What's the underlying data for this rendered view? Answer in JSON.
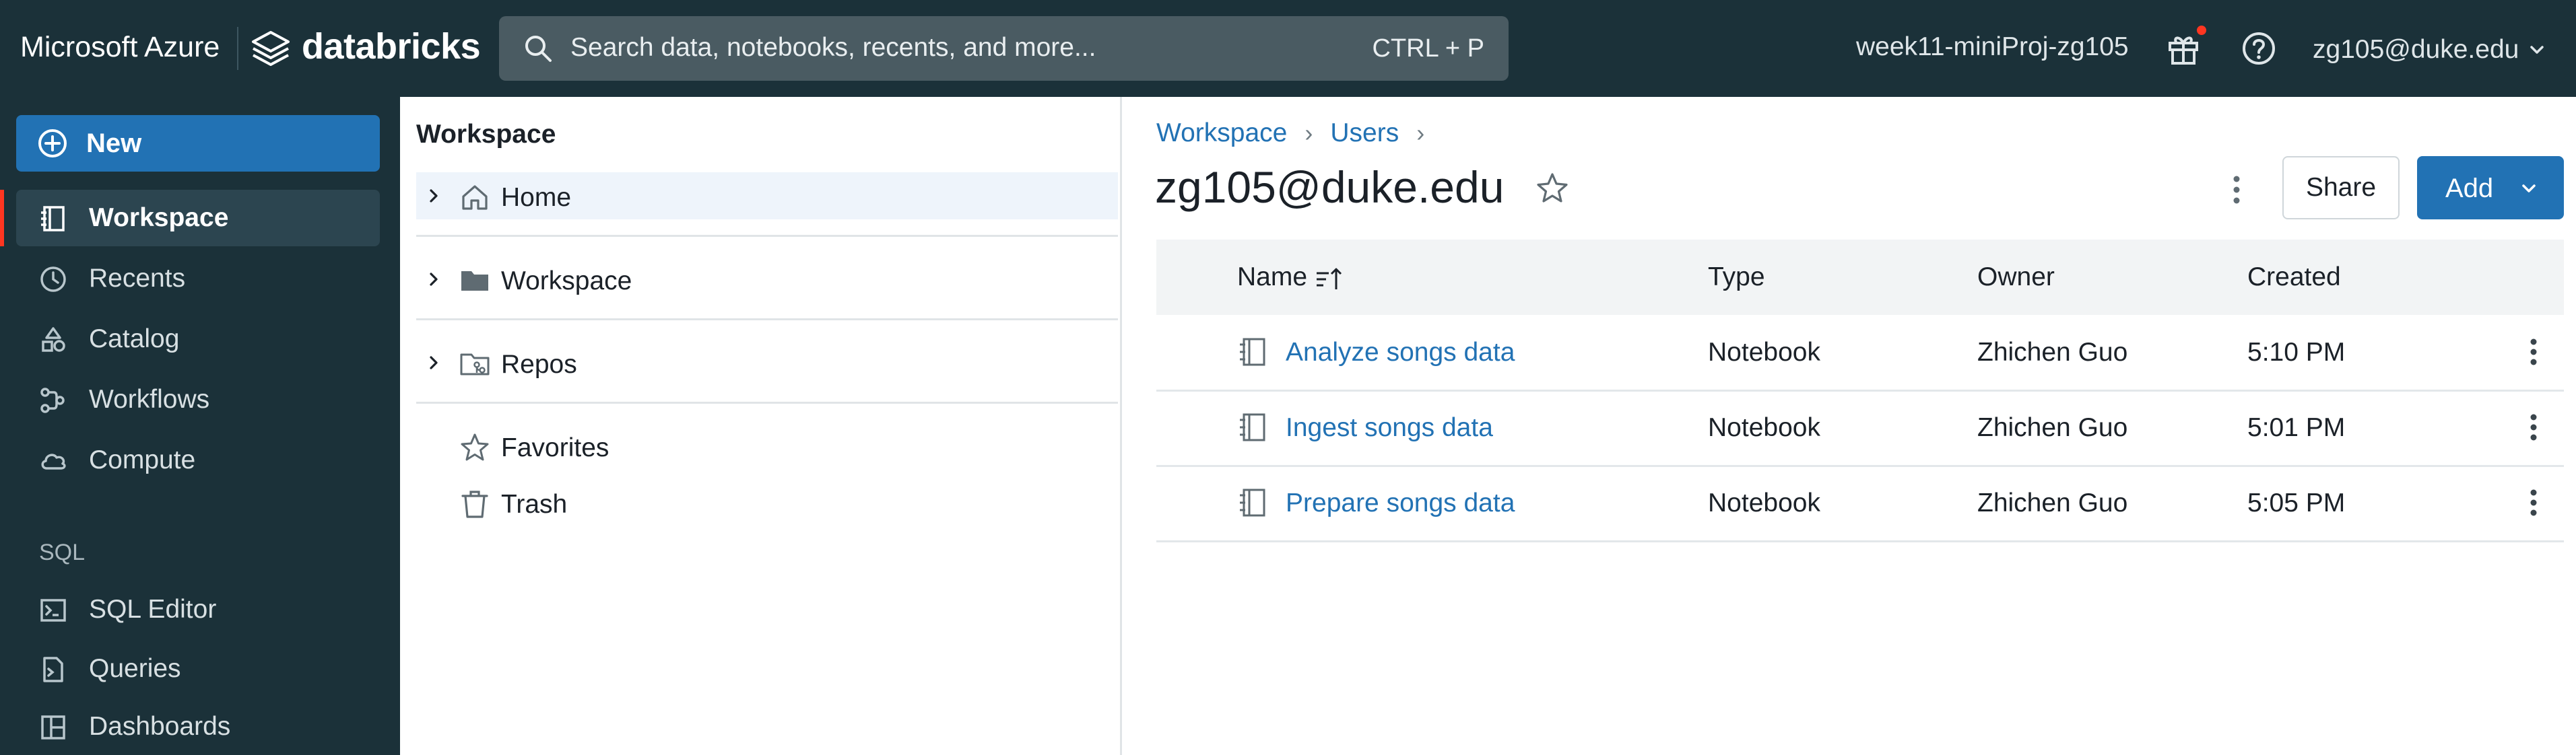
{
  "topbar": {
    "microsoft_label": "Microsoft Azure",
    "databricks_label": "databricks",
    "search_placeholder": "Search data, notebooks, recents, and more...",
    "search_shortcut": "CTRL + P",
    "workspace_name": "week11-miniProj-zg105",
    "user": "zg105@duke.edu"
  },
  "sidebar": {
    "new_label": "New",
    "items": [
      {
        "label": "Workspace",
        "icon": "workspace-icon",
        "active": true
      },
      {
        "label": "Recents",
        "icon": "clock-icon"
      },
      {
        "label": "Catalog",
        "icon": "catalog-icon"
      },
      {
        "label": "Workflows",
        "icon": "workflows-icon"
      },
      {
        "label": "Compute",
        "icon": "cloud-icon"
      }
    ],
    "sql_section": "SQL",
    "sql_items": [
      {
        "label": "SQL Editor",
        "icon": "sql-editor-icon"
      },
      {
        "label": "Queries",
        "icon": "queries-icon"
      },
      {
        "label": "Dashboards",
        "icon": "dashboards-icon"
      }
    ]
  },
  "tree": {
    "title": "Workspace",
    "items": [
      {
        "label": "Home",
        "icon": "home-icon"
      },
      {
        "label": "Workspace",
        "icon": "folder-icon"
      },
      {
        "label": "Repos",
        "icon": "repos-icon"
      },
      {
        "label": "Favorites",
        "icon": "star-icon"
      },
      {
        "label": "Trash",
        "icon": "trash-icon"
      }
    ]
  },
  "main": {
    "breadcrumb": [
      "Workspace",
      "Users"
    ],
    "title": "zg105@duke.edu",
    "share_label": "Share",
    "add_label": "Add",
    "columns": [
      "Name",
      "Type",
      "Owner",
      "Created"
    ],
    "rows": [
      {
        "name": "Analyze songs data",
        "type": "Notebook",
        "owner": "Zhichen Guo",
        "created": "5:10 PM"
      },
      {
        "name": "Ingest songs data",
        "type": "Notebook",
        "owner": "Zhichen Guo",
        "created": "5:01 PM"
      },
      {
        "name": "Prepare songs data",
        "type": "Notebook",
        "owner": "Zhichen Guo",
        "created": "5:05 PM"
      }
    ]
  },
  "colors": {
    "topbar_bg": "#1b3139",
    "accent_blue": "#2272b4",
    "active_marker": "#ff3621"
  }
}
